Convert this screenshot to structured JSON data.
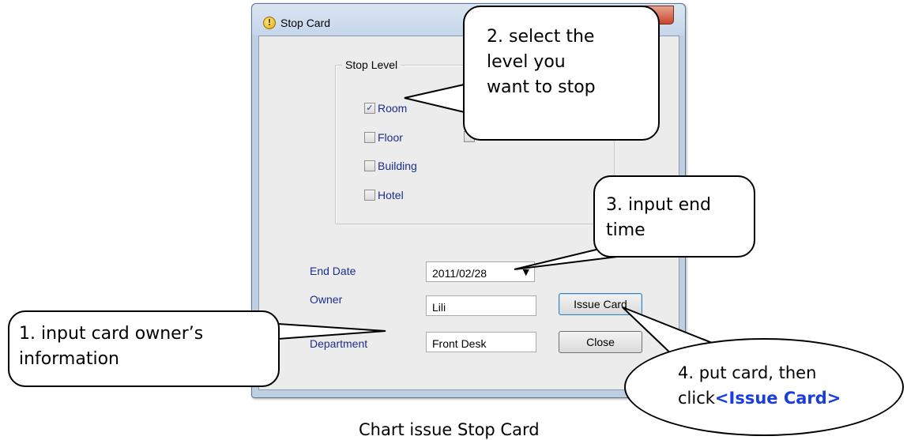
{
  "window": {
    "title": "Stop Card",
    "icon": "info-icon",
    "group_label": "Stop Level",
    "checkboxes": [
      {
        "label": "Room",
        "checked": true
      },
      {
        "label": "Floor",
        "checked": false
      },
      {
        "label": "Building",
        "checked": false
      },
      {
        "label": "Hotel",
        "checked": false
      }
    ],
    "end_date_label": "End Date",
    "end_date_value": "2011/02/28",
    "owner_label": "Owner",
    "owner_value": "Lili",
    "department_label": "Department",
    "department_value": "Front Desk",
    "issue_button": "Issue Card",
    "close_button": "Close"
  },
  "callouts": {
    "c1_line1": "1. input card owner’s",
    "c1_line2": "information",
    "c2_line1": "2. select the",
    "c2_line2": "level you",
    "c2_line3": "want to stop",
    "c3_line1": "3. input end",
    "c3_line2": "time",
    "c4_line1": "4. put card, then",
    "c4_prefix": "click",
    "c4_highlight": "<Issue Card>"
  },
  "caption": "Chart   issue Stop Card",
  "colors": {
    "label_blue": "#1c2d8a",
    "highlight_blue": "#1a3ce0",
    "close_red": "#c8452b"
  }
}
